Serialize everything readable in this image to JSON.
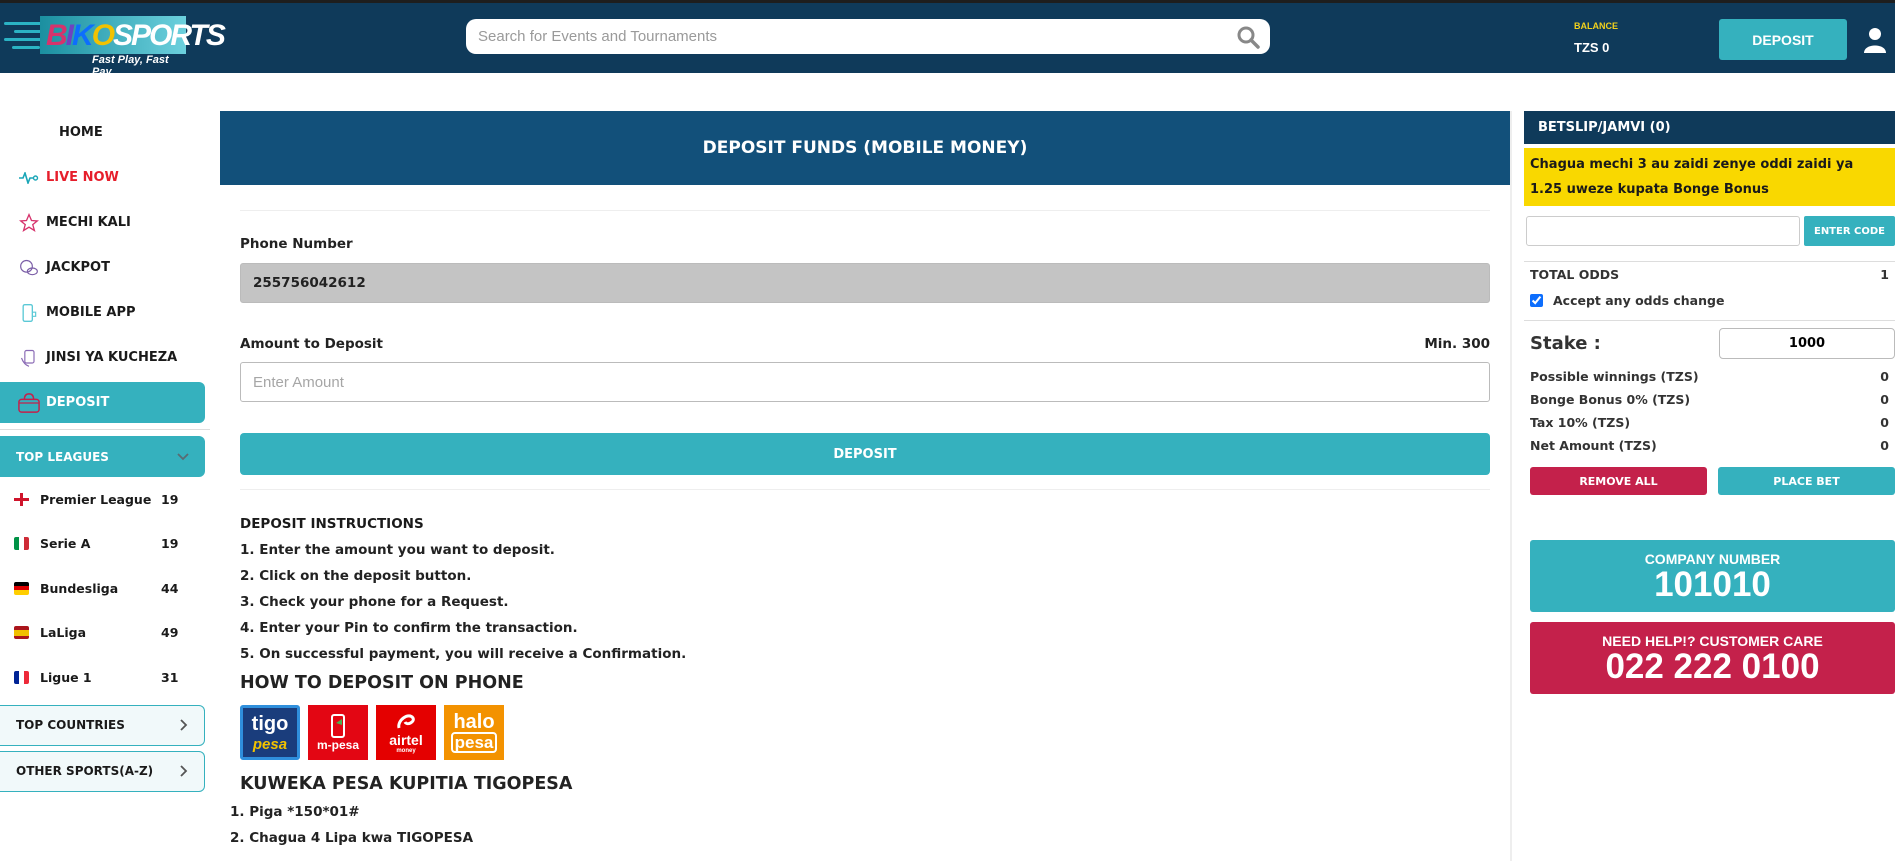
{
  "header": {
    "logo": {
      "text_parts": [
        "B",
        "I",
        "K",
        "O",
        "SPORTS"
      ],
      "tagline": "Fast Play, Fast Pay"
    },
    "search": {
      "placeholder": "Search for Events and Tournaments",
      "value": "",
      "icon": "search-icon"
    },
    "balance": {
      "label": "BALANCE",
      "value": "TZS 0"
    },
    "deposit_label": "DEPOSIT",
    "user_icon": "user-icon"
  },
  "sidebar": {
    "nav": [
      {
        "label": "HOME",
        "icon": ""
      },
      {
        "label": "LIVE NOW",
        "icon": "pulse-icon"
      },
      {
        "label": "MECHI KALI",
        "icon": "star-icon"
      },
      {
        "label": "JACKPOT",
        "icon": "balls-icon"
      },
      {
        "label": "MOBILE APP",
        "icon": "phone-icon"
      },
      {
        "label": "JINSI YA KUCHEZA",
        "icon": "guide-icon"
      },
      {
        "label": "DEPOSIT",
        "icon": "basket-icon",
        "active": true
      }
    ],
    "top_leagues": {
      "label": "TOP LEAGUES",
      "items": [
        {
          "name": "Premier League",
          "count": "19",
          "flag": "england"
        },
        {
          "name": "Serie A",
          "count": "19",
          "flag": "italy"
        },
        {
          "name": "Bundesliga",
          "count": "44",
          "flag": "germany"
        },
        {
          "name": "LaLiga",
          "count": "49",
          "flag": "spain"
        },
        {
          "name": "Ligue 1",
          "count": "31",
          "flag": "france"
        }
      ]
    },
    "top_countries": "TOP COUNTRIES",
    "other_sports": "OTHER SPORTS(A-Z)"
  },
  "main": {
    "title": "DEPOSIT FUNDS (MOBILE MONEY)",
    "phone_label": "Phone Number",
    "phone_value": "255756042612",
    "amount_label": "Amount to Deposit",
    "min_label": "Min. 300",
    "amount_placeholder": "Enter Amount",
    "amount_value": "",
    "deposit_button": "DEPOSIT",
    "instructions_title": "DEPOSIT INSTRUCTIONS",
    "instructions": [
      "1. Enter the amount you want to deposit.",
      "2. Click on the deposit button.",
      "3. Check your phone for a Request.",
      "4. Enter your Pin to confirm the transaction.",
      "5. On successful payment, you will receive a Confirmation."
    ],
    "how_to_title": "HOW TO DEPOSIT ON PHONE",
    "providers": [
      {
        "top": "tigo",
        "bottom": "pesa",
        "color": "#1a3d7c",
        "selected": true
      },
      {
        "top": "",
        "bottom": "m-pesa",
        "color": "#e30613",
        "selected": false
      },
      {
        "top": "airtel",
        "bottom": "money",
        "color": "#e40000",
        "selected": false
      },
      {
        "top": "halo",
        "bottom": "pesa",
        "color": "#f39200",
        "selected": false
      }
    ],
    "provider_title": "KUWEKA PESA KUPITIA TIGOPESA",
    "provider_steps": [
      "1. Piga *150*01#",
      "2. Chagua 4 Lipa kwa TIGOPESA"
    ]
  },
  "betslip": {
    "title": "BETSLIP/JAMVI (0)",
    "promo": "Chagua mechi 3 au zaidi zenye oddi zaidi ya 1.25 uweze kupata Bonge Bonus",
    "code_placeholder": "",
    "code_button": "ENTER CODE",
    "total_odds_label": "TOTAL ODDS",
    "total_odds_value": "1",
    "accept_label": "Accept any odds change",
    "accept_checked": true,
    "stake_label": "Stake :",
    "stake_value": "1000",
    "rows": [
      {
        "label": "Possible winnings (TZS)",
        "value": "0"
      },
      {
        "label": "Bonge Bonus 0% (TZS)",
        "value": "0"
      },
      {
        "label": "Tax 10% (TZS)",
        "value": "0"
      },
      {
        "label": "Net Amount (TZS)",
        "value": "0"
      }
    ],
    "remove_all": "REMOVE ALL",
    "place_bet": "PLACE BET",
    "company": {
      "label": "COMPANY NUMBER",
      "number": "101010"
    },
    "care": {
      "label": "NEED HELP!? CUSTOMER CARE",
      "number": "022 222 0100"
    }
  },
  "colors": {
    "header": "#0f3a5a",
    "accent": "#35b1be",
    "banner": "#12507a",
    "danger": "#c4214b",
    "promo": "#f9d800",
    "live": "#e61e2b"
  }
}
